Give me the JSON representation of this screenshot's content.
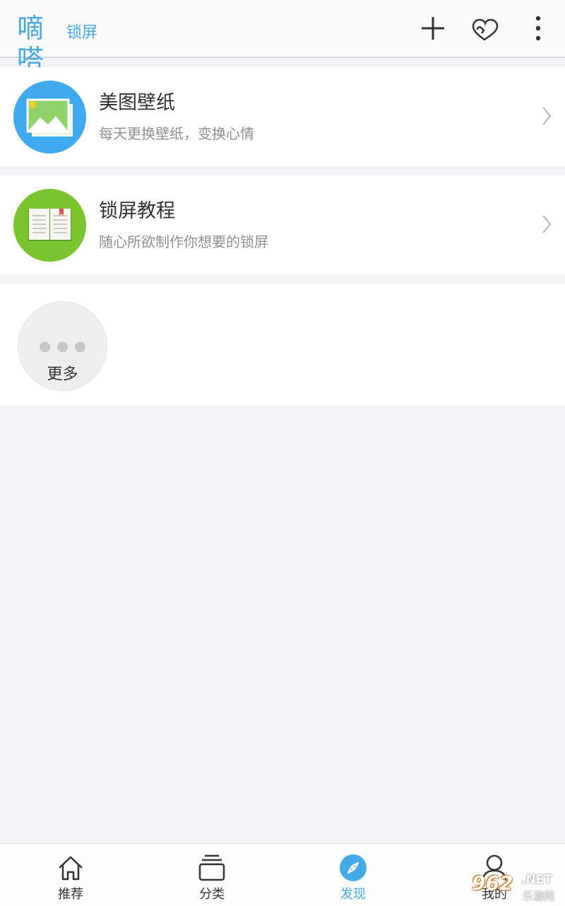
{
  "header": {
    "logo_main": "嘀嗒",
    "logo_sub": "锁屏",
    "icons": [
      "add-icon",
      "hearts-icon",
      "more-vertical-icon"
    ]
  },
  "cards": [
    {
      "title": "美图壁纸",
      "subtitle": "每天更换壁纸，变换心情",
      "icon": "picture-icon",
      "color": "#3fa9ee"
    },
    {
      "title": "锁屏教程",
      "subtitle": "随心所欲制作你想要的锁屏",
      "icon": "book-icon",
      "color": "#7ac52f"
    }
  ],
  "more": {
    "label": "更多"
  },
  "tabs": [
    {
      "label": "推荐",
      "icon": "home-icon"
    },
    {
      "label": "分类",
      "icon": "stack-icon"
    },
    {
      "label": "发现",
      "icon": "compass-icon",
      "active": true
    },
    {
      "label": "我的",
      "icon": "user-icon"
    }
  ],
  "watermark": {
    "number": "962",
    "net": ".NET",
    "text": "乐游网"
  },
  "colors": {
    "accent": "#45a9e6",
    "background": "#f2f3f5"
  }
}
